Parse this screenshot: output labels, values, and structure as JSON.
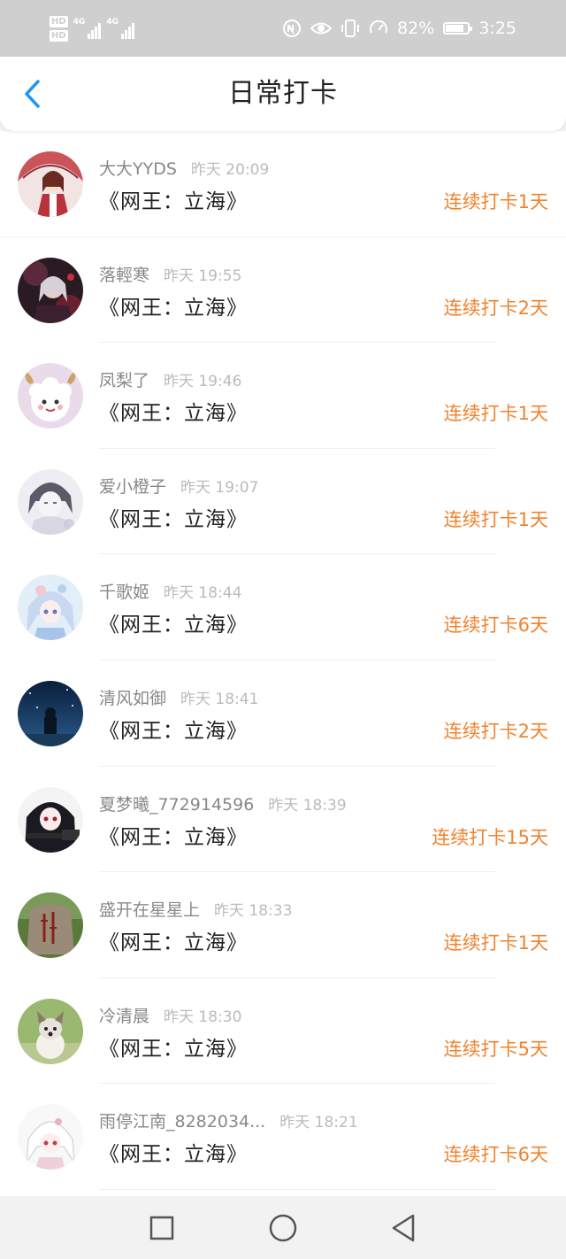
{
  "status_bar": {
    "hd1": "HD",
    "hd2": "HD",
    "net1": "4G",
    "net2": "4G",
    "battery_text": "82%",
    "battery_level": 0.82,
    "time": "3:25",
    "icons": [
      "nfc-icon",
      "eye-icon",
      "vibrate-icon",
      "speed-icon"
    ]
  },
  "header": {
    "title": "日常打卡",
    "back_icon": "chevron-left-icon",
    "accent": "#2196f3"
  },
  "colors": {
    "streak": "#f0832e",
    "username": "#888888",
    "time": "#bbbbbb",
    "title": "#222222"
  },
  "items": [
    {
      "user": "大大YYDS",
      "time": "昨天 20:09",
      "book": "《网王：立海》",
      "streak": "连续打卡1天",
      "avatar": "avatar-girl-umbrella"
    },
    {
      "user": "落輕寒",
      "time": "昨天 19:55",
      "book": "《网王：立海》",
      "streak": "连续打卡2天",
      "avatar": "avatar-dark-anime"
    },
    {
      "user": "凤梨了",
      "time": "昨天 19:46",
      "book": "《网王：立海》",
      "streak": "连续打卡1天",
      "avatar": "avatar-sheep"
    },
    {
      "user": "爱小橙子",
      "time": "昨天 19:07",
      "book": "《网王：立海》",
      "streak": "连续打卡1天",
      "avatar": "avatar-sketch-boy"
    },
    {
      "user": "千歌姬",
      "time": "昨天 18:44",
      "book": "《网王：立海》",
      "streak": "连续打卡6天",
      "avatar": "avatar-blue-girl"
    },
    {
      "user": "清风如御",
      "time": "昨天 18:41",
      "book": "《网王：立海》",
      "streak": "连续打卡2天",
      "avatar": "avatar-night-sky"
    },
    {
      "user": "夏梦曦_772914596",
      "time": "昨天 18:39",
      "book": "《网王：立海》",
      "streak": "连续打卡15天",
      "avatar": "avatar-black-hair-girl"
    },
    {
      "user": "盛开在星星上",
      "time": "昨天 18:33",
      "book": "《网王：立海》",
      "streak": "连续打卡1天",
      "avatar": "avatar-stone"
    },
    {
      "user": "冷清晨",
      "time": "昨天 18:30",
      "book": "《网王：立海》",
      "streak": "连续打卡5天",
      "avatar": "avatar-puppy"
    },
    {
      "user": "雨停江南_8282034...",
      "time": "昨天 18:21",
      "book": "《网王：立海》",
      "streak": "连续打卡6天",
      "avatar": "avatar-white-hair-chibi"
    }
  ],
  "nav": {
    "recent": "square-icon",
    "home": "circle-icon",
    "back": "triangle-back-icon"
  }
}
